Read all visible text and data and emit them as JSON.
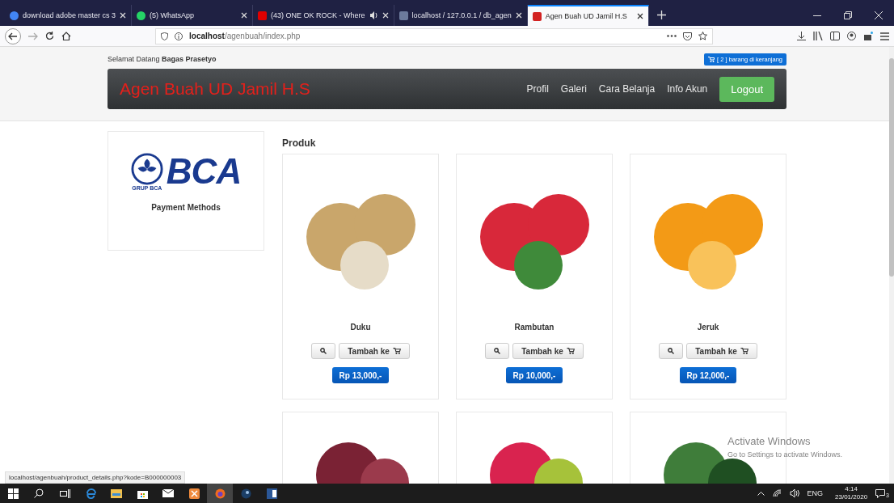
{
  "browser": {
    "tabs": [
      {
        "title": "download adobe master cs 3",
        "selected": false
      },
      {
        "title": "(5) WhatsApp",
        "selected": false
      },
      {
        "title": "(43) ONE OK ROCK - Where",
        "selected": false,
        "audio": true
      },
      {
        "title": "localhost / 127.0.0.1 / db_agen",
        "selected": false
      },
      {
        "title": "Agen Buah UD Jamil H.S",
        "selected": true
      }
    ],
    "address": {
      "host": "localhost",
      "path": "/agenbuah/index.php"
    },
    "status_link": "localhost/agenbuah/product_details.php?kode=B000000003"
  },
  "page": {
    "welcome": "Selamat Datang **Bagas Prasetyo**",
    "cart_button": "[ 2 ] barang di keranjang",
    "brand": "Agen Buah UD Jamil H.S",
    "nav": [
      "Profil",
      "Galeri",
      "Cara Belanja",
      "Info Akun"
    ],
    "logout": "Logout",
    "sidebar": {
      "logo_text": "BCA",
      "logo_sub": "GRUP BCA",
      "caption": "Payment Methods"
    },
    "section_title": "Produk",
    "products": [
      {
        "name": "Duku",
        "add_label": "Tambah ke",
        "price": "Rp 13,000,-"
      },
      {
        "name": "Rambutan",
        "add_label": "Tambah ke",
        "price": "Rp 10,000,-"
      },
      {
        "name": "Jeruk",
        "add_label": "Tambah ke",
        "price": "Rp 12,000,-"
      }
    ]
  },
  "activation": {
    "title": "Activate Windows",
    "subtitle": "Go to Settings to activate Windows."
  },
  "taskbar": {
    "language": "ENG",
    "time": "4:14",
    "date": "23/01/2020",
    "notifications": "3"
  }
}
